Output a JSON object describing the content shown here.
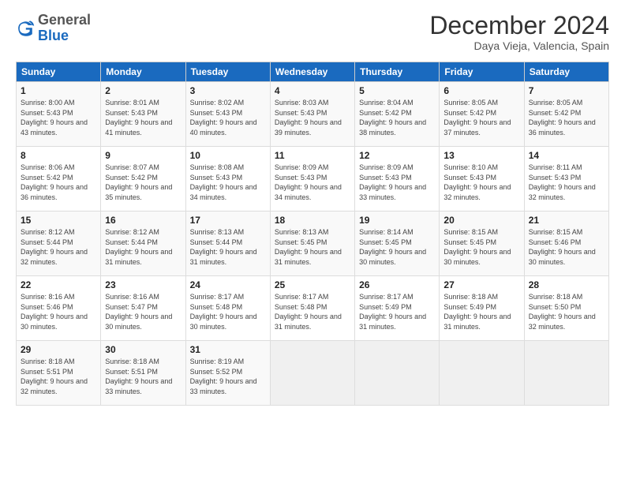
{
  "logo": {
    "general": "General",
    "blue": "Blue"
  },
  "header": {
    "month": "December 2024",
    "location": "Daya Vieja, Valencia, Spain"
  },
  "weekdays": [
    "Sunday",
    "Monday",
    "Tuesday",
    "Wednesday",
    "Thursday",
    "Friday",
    "Saturday"
  ],
  "days": [
    {
      "date": 1,
      "sunrise": "8:00 AM",
      "sunset": "5:43 PM",
      "daylight": "9 hours and 43 minutes."
    },
    {
      "date": 2,
      "sunrise": "8:01 AM",
      "sunset": "5:43 PM",
      "daylight": "9 hours and 41 minutes."
    },
    {
      "date": 3,
      "sunrise": "8:02 AM",
      "sunset": "5:43 PM",
      "daylight": "9 hours and 40 minutes."
    },
    {
      "date": 4,
      "sunrise": "8:03 AM",
      "sunset": "5:43 PM",
      "daylight": "9 hours and 39 minutes."
    },
    {
      "date": 5,
      "sunrise": "8:04 AM",
      "sunset": "5:42 PM",
      "daylight": "9 hours and 38 minutes."
    },
    {
      "date": 6,
      "sunrise": "8:05 AM",
      "sunset": "5:42 PM",
      "daylight": "9 hours and 37 minutes."
    },
    {
      "date": 7,
      "sunrise": "8:05 AM",
      "sunset": "5:42 PM",
      "daylight": "9 hours and 36 minutes."
    },
    {
      "date": 8,
      "sunrise": "8:06 AM",
      "sunset": "5:42 PM",
      "daylight": "9 hours and 36 minutes."
    },
    {
      "date": 9,
      "sunrise": "8:07 AM",
      "sunset": "5:42 PM",
      "daylight": "9 hours and 35 minutes."
    },
    {
      "date": 10,
      "sunrise": "8:08 AM",
      "sunset": "5:43 PM",
      "daylight": "9 hours and 34 minutes."
    },
    {
      "date": 11,
      "sunrise": "8:09 AM",
      "sunset": "5:43 PM",
      "daylight": "9 hours and 34 minutes."
    },
    {
      "date": 12,
      "sunrise": "8:09 AM",
      "sunset": "5:43 PM",
      "daylight": "9 hours and 33 minutes."
    },
    {
      "date": 13,
      "sunrise": "8:10 AM",
      "sunset": "5:43 PM",
      "daylight": "9 hours and 32 minutes."
    },
    {
      "date": 14,
      "sunrise": "8:11 AM",
      "sunset": "5:43 PM",
      "daylight": "9 hours and 32 minutes."
    },
    {
      "date": 15,
      "sunrise": "8:12 AM",
      "sunset": "5:44 PM",
      "daylight": "9 hours and 32 minutes."
    },
    {
      "date": 16,
      "sunrise": "8:12 AM",
      "sunset": "5:44 PM",
      "daylight": "9 hours and 31 minutes."
    },
    {
      "date": 17,
      "sunrise": "8:13 AM",
      "sunset": "5:44 PM",
      "daylight": "9 hours and 31 minutes."
    },
    {
      "date": 18,
      "sunrise": "8:13 AM",
      "sunset": "5:45 PM",
      "daylight": "9 hours and 31 minutes."
    },
    {
      "date": 19,
      "sunrise": "8:14 AM",
      "sunset": "5:45 PM",
      "daylight": "9 hours and 30 minutes."
    },
    {
      "date": 20,
      "sunrise": "8:15 AM",
      "sunset": "5:45 PM",
      "daylight": "9 hours and 30 minutes."
    },
    {
      "date": 21,
      "sunrise": "8:15 AM",
      "sunset": "5:46 PM",
      "daylight": "9 hours and 30 minutes."
    },
    {
      "date": 22,
      "sunrise": "8:16 AM",
      "sunset": "5:46 PM",
      "daylight": "9 hours and 30 minutes."
    },
    {
      "date": 23,
      "sunrise": "8:16 AM",
      "sunset": "5:47 PM",
      "daylight": "9 hours and 30 minutes."
    },
    {
      "date": 24,
      "sunrise": "8:17 AM",
      "sunset": "5:48 PM",
      "daylight": "9 hours and 30 minutes."
    },
    {
      "date": 25,
      "sunrise": "8:17 AM",
      "sunset": "5:48 PM",
      "daylight": "9 hours and 31 minutes."
    },
    {
      "date": 26,
      "sunrise": "8:17 AM",
      "sunset": "5:49 PM",
      "daylight": "9 hours and 31 minutes."
    },
    {
      "date": 27,
      "sunrise": "8:18 AM",
      "sunset": "5:49 PM",
      "daylight": "9 hours and 31 minutes."
    },
    {
      "date": 28,
      "sunrise": "8:18 AM",
      "sunset": "5:50 PM",
      "daylight": "9 hours and 32 minutes."
    },
    {
      "date": 29,
      "sunrise": "8:18 AM",
      "sunset": "5:51 PM",
      "daylight": "9 hours and 32 minutes."
    },
    {
      "date": 30,
      "sunrise": "8:18 AM",
      "sunset": "5:51 PM",
      "daylight": "9 hours and 33 minutes."
    },
    {
      "date": 31,
      "sunrise": "8:19 AM",
      "sunset": "5:52 PM",
      "daylight": "9 hours and 33 minutes."
    }
  ],
  "labels": {
    "sunrise": "Sunrise:",
    "sunset": "Sunset:",
    "daylight": "Daylight:"
  }
}
